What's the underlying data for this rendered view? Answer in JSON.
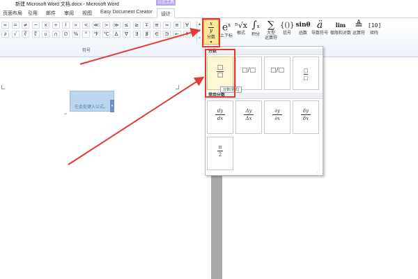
{
  "window": {
    "title": "新建 Microsoft Word 文档.docx - Microsoft Word",
    "context_tab_group": "公式工具"
  },
  "ribbon": {
    "tabs": [
      {
        "label": "页面布局"
      },
      {
        "label": "引用"
      },
      {
        "label": "邮件"
      },
      {
        "label": "审阅"
      },
      {
        "label": "视图"
      },
      {
        "label": "Easy Document Creator"
      },
      {
        "label": "设计"
      }
    ],
    "symbols_row1": [
      "∞",
      "=",
      "≠",
      "~",
      "×",
      "÷",
      "!",
      "∝",
      "<",
      "≪",
      ">",
      "≫",
      "≤",
      "≥",
      "∓",
      "≅",
      "≈",
      "≡",
      "∀"
    ],
    "symbols_row2": [
      "∂",
      "√",
      "∛",
      "∜",
      "∪",
      "∩",
      "∅",
      "%",
      "°",
      "℉",
      "℃",
      "∆",
      "∇",
      "∃",
      "∄",
      "∈",
      "∋",
      "←",
      "↑"
    ],
    "symbols_group_label": "符号",
    "structures": [
      {
        "label": "分数",
        "icon": "x/y"
      },
      {
        "label": "上下标",
        "icon": "eˣ"
      },
      {
        "label": "根式",
        "icon": "ⁿ√x"
      },
      {
        "label": "积分",
        "icon": "∫"
      },
      {
        "label": "大型\n运算符",
        "icon": "∑"
      },
      {
        "label": "括号",
        "icon": "{()}"
      },
      {
        "label": "函数",
        "icon": "sinθ"
      },
      {
        "label": "导数符号",
        "icon": "ä"
      },
      {
        "label": "极限和对数",
        "icon": "lim"
      },
      {
        "label": "运算符",
        "icon": "≜"
      },
      {
        "label": "矩阵",
        "icon": "[10]"
      }
    ]
  },
  "document": {
    "equation_placeholder": "在此处键入公式。",
    "paragraph_mark": "↵"
  },
  "fraction_menu": {
    "section_title": "分数",
    "section2_title": "常用分数",
    "tooltip": "分数(竖式)",
    "items": [
      "□/□",
      "□/□",
      "□/□",
      "□"
    ],
    "common_fractions": [
      {
        "num": "dy",
        "den": "dx"
      },
      {
        "num": "Δy",
        "den": "Δx"
      },
      {
        "num": "∂y",
        "den": "∂x"
      },
      {
        "num": "δy",
        "den": "δx"
      },
      {
        "num": "π",
        "den": "2"
      }
    ]
  },
  "colors": {
    "highlight_red": "#e53935",
    "context_tab": "#b9a7f0",
    "selected_button": "#fde79a",
    "equation_box": "#bcd6f0"
  }
}
